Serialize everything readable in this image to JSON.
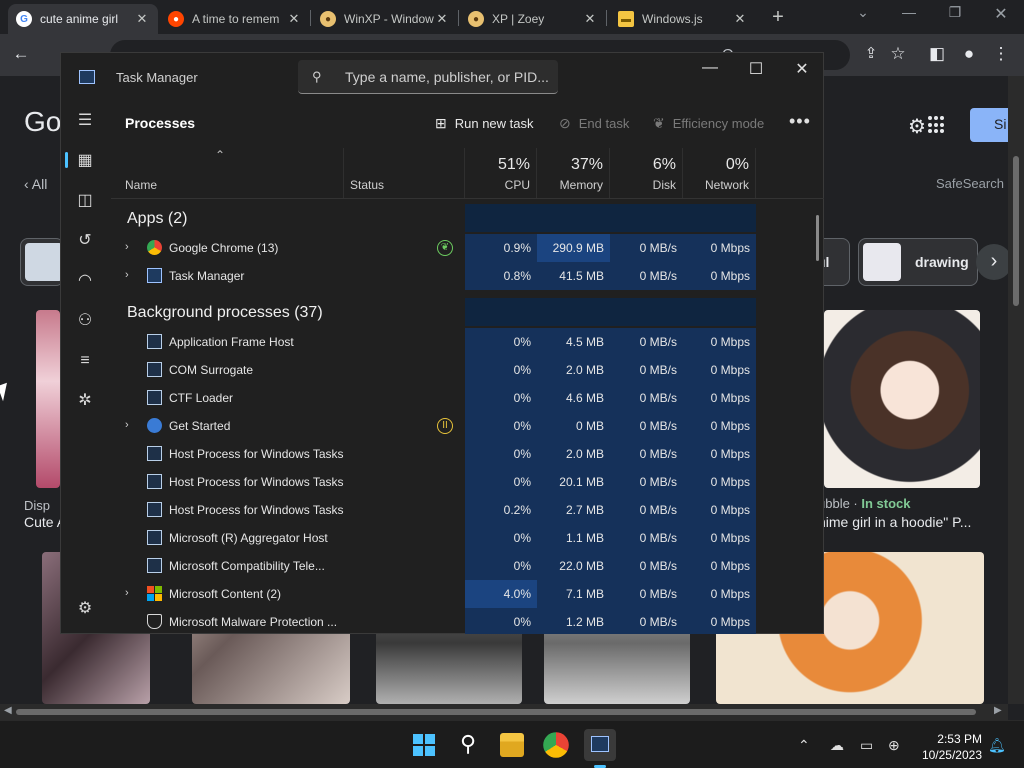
{
  "browser": {
    "tabs": [
      {
        "title": "cute anime girl",
        "favicon": "google-icon",
        "active": true
      },
      {
        "title": "A time to remem",
        "favicon": "reddit-icon",
        "active": false
      },
      {
        "title": "WinXP - Window",
        "favicon": "winxp-icon",
        "active": false
      },
      {
        "title": "XP | Zoey",
        "favicon": "winxp-icon",
        "active": false
      },
      {
        "title": "Windows.js",
        "favicon": "folder-icon",
        "active": false
      }
    ],
    "new_tab": "+",
    "close_tab": "✕",
    "omnibox_suffix": "Q..."
  },
  "google": {
    "logo": "Go",
    "nav_all": "All",
    "safesearch": "SafeSearch",
    "signin": "Si",
    "chips": [
      {
        "label": "ul"
      },
      {
        "label": "drawing"
      }
    ],
    "captions": [
      {
        "text": "Disp"
      },
      {
        "text": "Cute A"
      },
      {
        "text": "ubble · ",
        "stock": "In stock"
      },
      {
        "text": "nime girl in a hoodie\" P..."
      }
    ]
  },
  "task_manager": {
    "title": "Task Manager",
    "search_placeholder": "Type a name, publisher, or PID...",
    "page_title": "Processes",
    "commands": {
      "run_new_task": "Run new task",
      "end_task": "End task",
      "efficiency_mode": "Efficiency mode"
    },
    "columns": {
      "name": "Name",
      "status": "Status",
      "cpu_pct": "51%",
      "cpu": "CPU",
      "mem_pct": "37%",
      "mem": "Memory",
      "disk_pct": "6%",
      "disk": "Disk",
      "net_pct": "0%",
      "net": "Network"
    },
    "apps_group": "Apps (2)",
    "bg_group": "Background processes (37)",
    "apps": [
      {
        "name": "Google Chrome (13)",
        "expand": true,
        "icon": "chrome",
        "status": "efficiency-leaf-icon",
        "cpu": "0.9%",
        "mem": "290.9 MB",
        "disk": "0 MB/s",
        "net": "0 Mbps",
        "mem_heat": 2
      },
      {
        "name": "Task Manager",
        "expand": true,
        "icon": "taskmgr",
        "status": "",
        "cpu": "0.8%",
        "mem": "41.5 MB",
        "disk": "0 MB/s",
        "net": "0 Mbps",
        "mem_heat": 1
      }
    ],
    "background": [
      {
        "name": "Application Frame Host",
        "expand": false,
        "icon": "sys",
        "status": "",
        "cpu": "0%",
        "mem": "4.5 MB",
        "disk": "0 MB/s",
        "net": "0 Mbps",
        "cpu_heat": 1
      },
      {
        "name": "COM Surrogate",
        "expand": false,
        "icon": "sys",
        "status": "",
        "cpu": "0%",
        "mem": "2.0 MB",
        "disk": "0 MB/s",
        "net": "0 Mbps",
        "cpu_heat": 1
      },
      {
        "name": "CTF Loader",
        "expand": false,
        "icon": "sys",
        "status": "",
        "cpu": "0%",
        "mem": "4.6 MB",
        "disk": "0 MB/s",
        "net": "0 Mbps",
        "cpu_heat": 1
      },
      {
        "name": "Get Started",
        "expand": true,
        "icon": "getstarted",
        "status": "suspended-icon",
        "cpu": "0%",
        "mem": "0 MB",
        "disk": "0 MB/s",
        "net": "0 Mbps",
        "cpu_heat": 1
      },
      {
        "name": "Host Process for Windows Tasks",
        "expand": false,
        "icon": "sys",
        "status": "",
        "cpu": "0%",
        "mem": "2.0 MB",
        "disk": "0 MB/s",
        "net": "0 Mbps",
        "cpu_heat": 1
      },
      {
        "name": "Host Process for Windows Tasks",
        "expand": false,
        "icon": "sys",
        "status": "",
        "cpu": "0%",
        "mem": "20.1 MB",
        "disk": "0 MB/s",
        "net": "0 Mbps",
        "cpu_heat": 1
      },
      {
        "name": "Host Process for Windows Tasks",
        "expand": false,
        "icon": "sys",
        "status": "",
        "cpu": "0.2%",
        "mem": "2.7 MB",
        "disk": "0 MB/s",
        "net": "0 Mbps",
        "cpu_heat": 1
      },
      {
        "name": "Microsoft (R) Aggregator Host",
        "expand": false,
        "icon": "sys",
        "status": "",
        "cpu": "0%",
        "mem": "1.1 MB",
        "disk": "0 MB/s",
        "net": "0 Mbps",
        "cpu_heat": 1
      },
      {
        "name": "Microsoft Compatibility Tele...",
        "expand": false,
        "icon": "sys",
        "status": "",
        "cpu": "0%",
        "mem": "22.0 MB",
        "disk": "0 MB/s",
        "net": "0 Mbps",
        "cpu_heat": 1
      },
      {
        "name": "Microsoft Content (2)",
        "expand": true,
        "icon": "ms",
        "status": "",
        "cpu": "4.0%",
        "mem": "7.1 MB",
        "disk": "0 MB/s",
        "net": "0 Mbps",
        "cpu_heat": 2
      },
      {
        "name": "Microsoft Malware Protection ...",
        "expand": false,
        "icon": "shield",
        "status": "",
        "cpu": "0%",
        "mem": "1.2 MB",
        "disk": "0 MB/s",
        "net": "0 Mbps",
        "cpu_heat": 1
      }
    ]
  },
  "taskbar": {
    "apps": [
      "start-icon",
      "search-icon",
      "file-explorer-icon",
      "chrome-icon",
      "task-manager-icon"
    ],
    "time": "2:53 PM",
    "date": "10/25/2023"
  },
  "colors": {
    "accent": "#4cc2ff",
    "heat_low": "#0f2540",
    "heat_mid": "#15315a",
    "heat_high": "#1b4480"
  }
}
